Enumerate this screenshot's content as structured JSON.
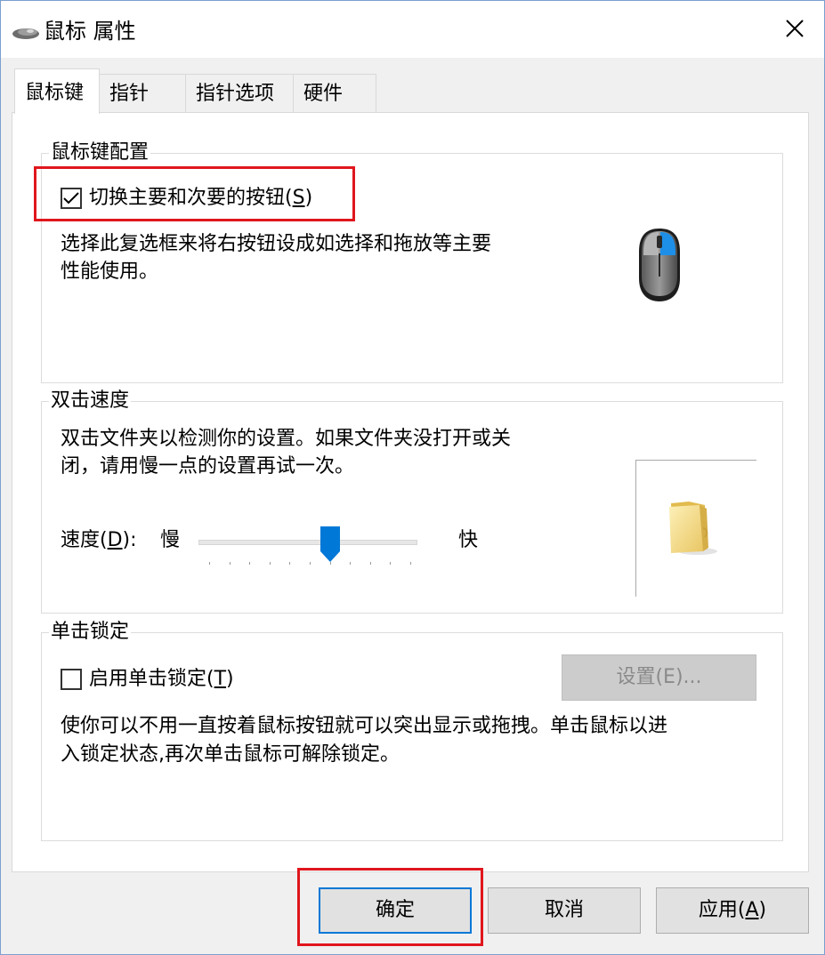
{
  "window": {
    "title": "鼠标 属性",
    "close_icon": "close-icon"
  },
  "tabs": [
    {
      "label": "鼠标键",
      "active": true
    },
    {
      "label": "指针",
      "active": false
    },
    {
      "label": "指针选项",
      "active": false
    },
    {
      "label": "硬件",
      "active": false
    }
  ],
  "button_config": {
    "title": "鼠标键配置",
    "checkbox_label_pre": "切换主要和次要的按钮(",
    "checkbox_label_key": "S",
    "checkbox_label_post": ")",
    "checked": true,
    "desc_line1": "选择此复选框来将右按钮设成如选择和拖放等主要",
    "desc_line2": "性能使用。",
    "mouse_icon": "mouse-icon"
  },
  "double_click": {
    "title": "双击速度",
    "desc_line1": "双击文件夹以检测你的设置。如果文件夹没打开或关",
    "desc_line2": "闭，请用慢一点的设置再试一次。",
    "speed_label_pre": "速度(",
    "speed_label_key": "D",
    "speed_label_post": "):",
    "slow_label": "慢",
    "fast_label": "快",
    "slider_position": 0.6,
    "folder_icon": "folder-icon"
  },
  "click_lock": {
    "title": "单击锁定",
    "checkbox_label_pre": "启用单击锁定(",
    "checkbox_label_key": "T",
    "checkbox_label_post": ")",
    "checked": false,
    "settings_button": "设置(E)...",
    "desc_line1": "使你可以不用一直按着鼠标按钮就可以突出显示或拖拽。单击鼠标以进",
    "desc_line2": "入锁定状态,再次单击鼠标可解除锁定。"
  },
  "footer": {
    "ok": "确定",
    "cancel": "取消",
    "apply_pre": "应用(",
    "apply_key": "A",
    "apply_post": ")"
  },
  "colors": {
    "highlight_frame": "#e0161d",
    "accent": "#0078d7"
  }
}
